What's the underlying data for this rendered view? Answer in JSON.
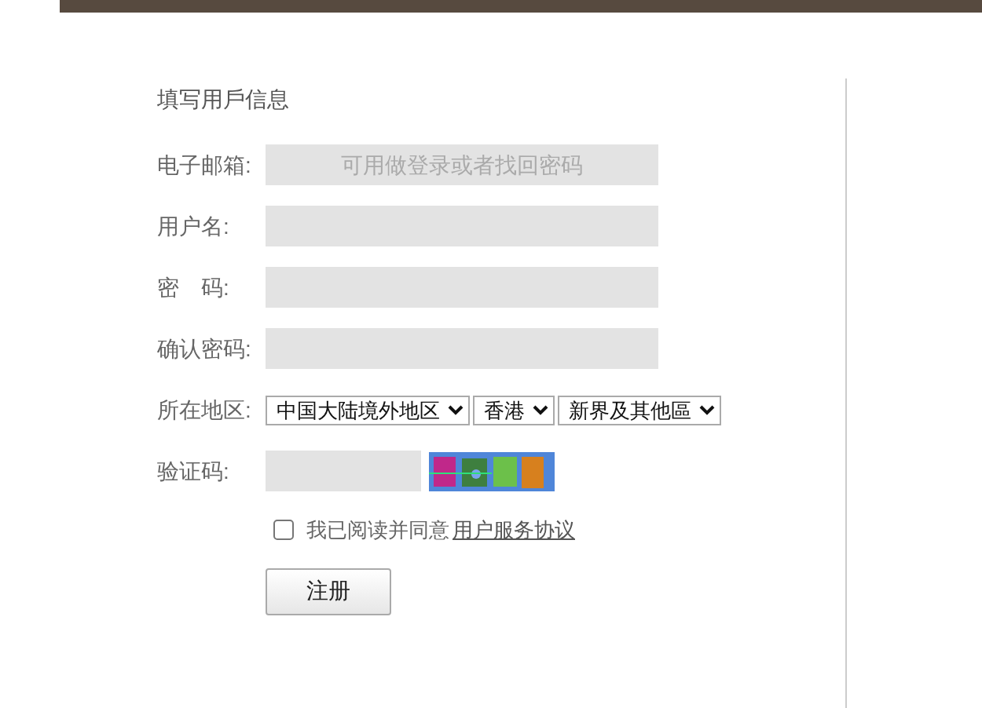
{
  "heading": "填写用戶信息",
  "fields": [
    {
      "label": "电子邮箱:",
      "placeholder": "可用做登录或者找回密码"
    },
    {
      "label": "用户名:"
    },
    {
      "label": "密　码:"
    },
    {
      "label": "确认密码:"
    }
  ],
  "region": {
    "label": "所在地区:",
    "selects": [
      "中国大陆境外地区",
      "香港",
      "新界及其他區"
    ]
  },
  "captcha": {
    "label": "验证码:"
  },
  "agreement": {
    "checked": false,
    "text": "我已阅读并同意",
    "link": "用户服务协议"
  },
  "submit": "注册"
}
